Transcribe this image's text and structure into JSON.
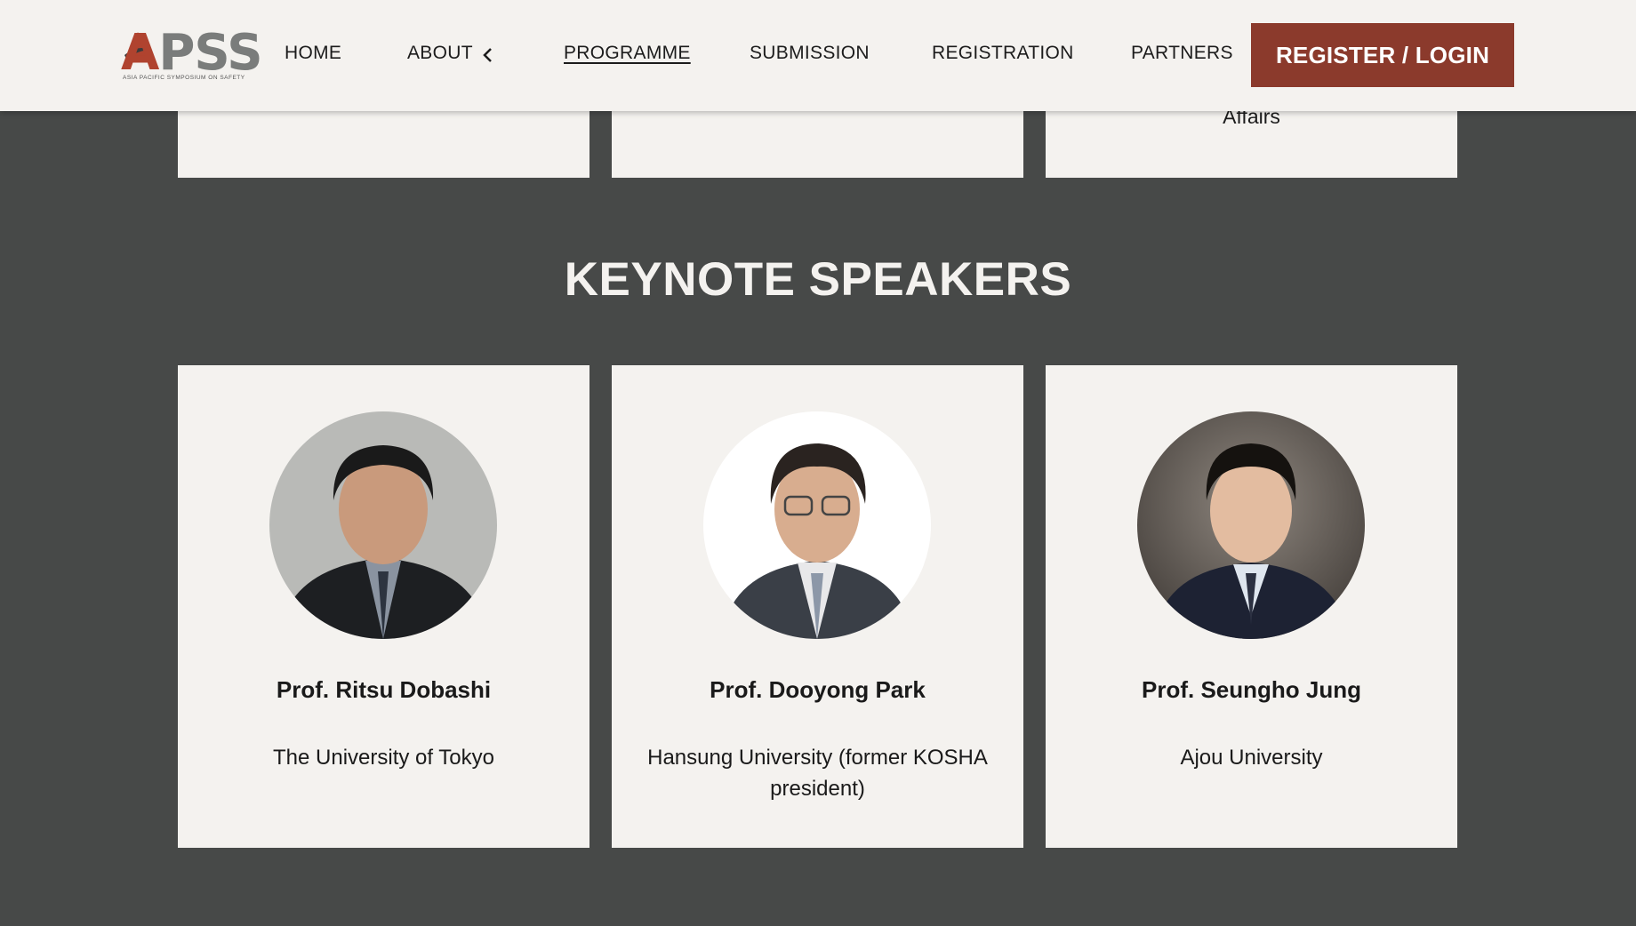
{
  "header": {
    "logo": {
      "main_text": "APSS",
      "sub_text": "ASIA PACIFIC SYMPOSIUM ON SAFETY"
    },
    "nav": [
      {
        "label": "HOME"
      },
      {
        "label": "ABOUT"
      },
      {
        "label": "PROGRAMME",
        "active": true
      },
      {
        "label": "SUBMISSION"
      },
      {
        "label": "REGISTRATION"
      },
      {
        "label": "PARTNERS"
      }
    ],
    "about_icon": "chevron-left-icon",
    "cta_label": "REGISTER / LOGIN",
    "colors": {
      "header_bg": "#f4f2ef",
      "cta_bg": "#8b3a2c",
      "logo_accent": "#b0432f"
    }
  },
  "top_cards": [
    {
      "text": ""
    },
    {
      "text": ""
    },
    {
      "text": "Affairs"
    }
  ],
  "keynote": {
    "title": "KEYNOTE SPEAKERS",
    "speakers": [
      {
        "name": "Prof. Ritsu Dobashi",
        "affiliation": "The University of Tokyo"
      },
      {
        "name": "Prof. Dooyong Park",
        "affiliation": "Hansung University (former KOSHA president)"
      },
      {
        "name": "Prof. Seungho Jung",
        "affiliation": "Ajou University"
      }
    ]
  },
  "colors": {
    "page_bg": "#474948",
    "card_bg": "#f4f2ef"
  }
}
